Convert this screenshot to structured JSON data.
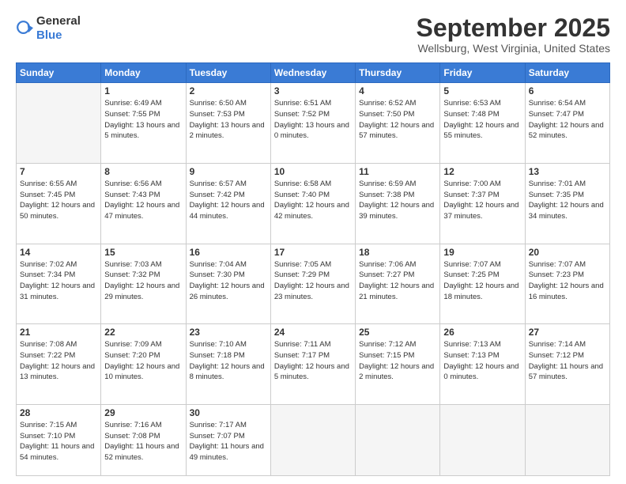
{
  "header": {
    "logo": {
      "text_general": "General",
      "text_blue": "Blue"
    },
    "title": "September 2025",
    "location": "Wellsburg, West Virginia, United States"
  },
  "calendar": {
    "columns": [
      "Sunday",
      "Monday",
      "Tuesday",
      "Wednesday",
      "Thursday",
      "Friday",
      "Saturday"
    ],
    "rows": [
      [
        {
          "day": "",
          "empty": true
        },
        {
          "day": "1",
          "sunrise": "Sunrise: 6:49 AM",
          "sunset": "Sunset: 7:55 PM",
          "daylight": "Daylight: 13 hours and 5 minutes."
        },
        {
          "day": "2",
          "sunrise": "Sunrise: 6:50 AM",
          "sunset": "Sunset: 7:53 PM",
          "daylight": "Daylight: 13 hours and 2 minutes."
        },
        {
          "day": "3",
          "sunrise": "Sunrise: 6:51 AM",
          "sunset": "Sunset: 7:52 PM",
          "daylight": "Daylight: 13 hours and 0 minutes."
        },
        {
          "day": "4",
          "sunrise": "Sunrise: 6:52 AM",
          "sunset": "Sunset: 7:50 PM",
          "daylight": "Daylight: 12 hours and 57 minutes."
        },
        {
          "day": "5",
          "sunrise": "Sunrise: 6:53 AM",
          "sunset": "Sunset: 7:48 PM",
          "daylight": "Daylight: 12 hours and 55 minutes."
        },
        {
          "day": "6",
          "sunrise": "Sunrise: 6:54 AM",
          "sunset": "Sunset: 7:47 PM",
          "daylight": "Daylight: 12 hours and 52 minutes."
        }
      ],
      [
        {
          "day": "7",
          "sunrise": "Sunrise: 6:55 AM",
          "sunset": "Sunset: 7:45 PM",
          "daylight": "Daylight: 12 hours and 50 minutes."
        },
        {
          "day": "8",
          "sunrise": "Sunrise: 6:56 AM",
          "sunset": "Sunset: 7:43 PM",
          "daylight": "Daylight: 12 hours and 47 minutes."
        },
        {
          "day": "9",
          "sunrise": "Sunrise: 6:57 AM",
          "sunset": "Sunset: 7:42 PM",
          "daylight": "Daylight: 12 hours and 44 minutes."
        },
        {
          "day": "10",
          "sunrise": "Sunrise: 6:58 AM",
          "sunset": "Sunset: 7:40 PM",
          "daylight": "Daylight: 12 hours and 42 minutes."
        },
        {
          "day": "11",
          "sunrise": "Sunrise: 6:59 AM",
          "sunset": "Sunset: 7:38 PM",
          "daylight": "Daylight: 12 hours and 39 minutes."
        },
        {
          "day": "12",
          "sunrise": "Sunrise: 7:00 AM",
          "sunset": "Sunset: 7:37 PM",
          "daylight": "Daylight: 12 hours and 37 minutes."
        },
        {
          "day": "13",
          "sunrise": "Sunrise: 7:01 AM",
          "sunset": "Sunset: 7:35 PM",
          "daylight": "Daylight: 12 hours and 34 minutes."
        }
      ],
      [
        {
          "day": "14",
          "sunrise": "Sunrise: 7:02 AM",
          "sunset": "Sunset: 7:34 PM",
          "daylight": "Daylight: 12 hours and 31 minutes."
        },
        {
          "day": "15",
          "sunrise": "Sunrise: 7:03 AM",
          "sunset": "Sunset: 7:32 PM",
          "daylight": "Daylight: 12 hours and 29 minutes."
        },
        {
          "day": "16",
          "sunrise": "Sunrise: 7:04 AM",
          "sunset": "Sunset: 7:30 PM",
          "daylight": "Daylight: 12 hours and 26 minutes."
        },
        {
          "day": "17",
          "sunrise": "Sunrise: 7:05 AM",
          "sunset": "Sunset: 7:29 PM",
          "daylight": "Daylight: 12 hours and 23 minutes."
        },
        {
          "day": "18",
          "sunrise": "Sunrise: 7:06 AM",
          "sunset": "Sunset: 7:27 PM",
          "daylight": "Daylight: 12 hours and 21 minutes."
        },
        {
          "day": "19",
          "sunrise": "Sunrise: 7:07 AM",
          "sunset": "Sunset: 7:25 PM",
          "daylight": "Daylight: 12 hours and 18 minutes."
        },
        {
          "day": "20",
          "sunrise": "Sunrise: 7:07 AM",
          "sunset": "Sunset: 7:23 PM",
          "daylight": "Daylight: 12 hours and 16 minutes."
        }
      ],
      [
        {
          "day": "21",
          "sunrise": "Sunrise: 7:08 AM",
          "sunset": "Sunset: 7:22 PM",
          "daylight": "Daylight: 12 hours and 13 minutes."
        },
        {
          "day": "22",
          "sunrise": "Sunrise: 7:09 AM",
          "sunset": "Sunset: 7:20 PM",
          "daylight": "Daylight: 12 hours and 10 minutes."
        },
        {
          "day": "23",
          "sunrise": "Sunrise: 7:10 AM",
          "sunset": "Sunset: 7:18 PM",
          "daylight": "Daylight: 12 hours and 8 minutes."
        },
        {
          "day": "24",
          "sunrise": "Sunrise: 7:11 AM",
          "sunset": "Sunset: 7:17 PM",
          "daylight": "Daylight: 12 hours and 5 minutes."
        },
        {
          "day": "25",
          "sunrise": "Sunrise: 7:12 AM",
          "sunset": "Sunset: 7:15 PM",
          "daylight": "Daylight: 12 hours and 2 minutes."
        },
        {
          "day": "26",
          "sunrise": "Sunrise: 7:13 AM",
          "sunset": "Sunset: 7:13 PM",
          "daylight": "Daylight: 12 hours and 0 minutes."
        },
        {
          "day": "27",
          "sunrise": "Sunrise: 7:14 AM",
          "sunset": "Sunset: 7:12 PM",
          "daylight": "Daylight: 11 hours and 57 minutes."
        }
      ],
      [
        {
          "day": "28",
          "sunrise": "Sunrise: 7:15 AM",
          "sunset": "Sunset: 7:10 PM",
          "daylight": "Daylight: 11 hours and 54 minutes."
        },
        {
          "day": "29",
          "sunrise": "Sunrise: 7:16 AM",
          "sunset": "Sunset: 7:08 PM",
          "daylight": "Daylight: 11 hours and 52 minutes."
        },
        {
          "day": "30",
          "sunrise": "Sunrise: 7:17 AM",
          "sunset": "Sunset: 7:07 PM",
          "daylight": "Daylight: 11 hours and 49 minutes."
        },
        {
          "day": "",
          "empty": true
        },
        {
          "day": "",
          "empty": true
        },
        {
          "day": "",
          "empty": true
        },
        {
          "day": "",
          "empty": true
        }
      ]
    ]
  }
}
